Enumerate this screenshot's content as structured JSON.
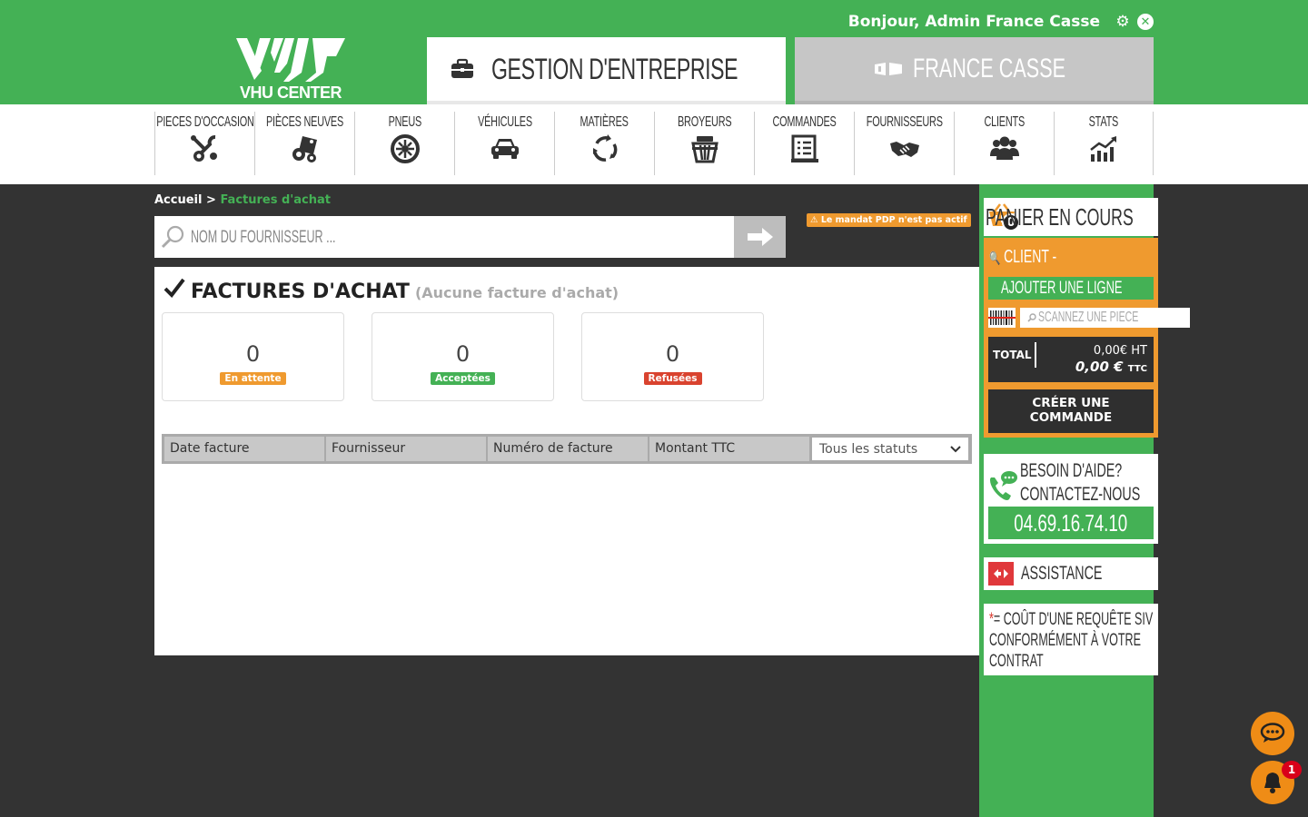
{
  "header": {
    "greeting": "Bonjour, Admin France Casse",
    "logo_text": "VHU CENTER",
    "tab_gestion": "GESTION D'ENTREPRISE",
    "tab_france": "FRANCE CASSE"
  },
  "nav": {
    "items": [
      {
        "label": "PIECES D'OCCASION",
        "icon": "tools-icon"
      },
      {
        "label": "PIÈCES NEUVES",
        "icon": "new-parts-icon"
      },
      {
        "label": "PNEUS",
        "icon": "tire-icon"
      },
      {
        "label": "VÉHICULES",
        "icon": "car-icon"
      },
      {
        "label": "MATIÈRES",
        "icon": "recycle-icon"
      },
      {
        "label": "BROYEURS",
        "icon": "shredder-icon"
      },
      {
        "label": "COMMANDES",
        "icon": "orders-icon"
      },
      {
        "label": "FOURNISSEURS",
        "icon": "handshake-icon"
      },
      {
        "label": "CLIENTS",
        "icon": "users-icon"
      },
      {
        "label": "STATS",
        "icon": "stats-icon"
      }
    ]
  },
  "breadcrumb": {
    "home": "Accueil",
    "separator": ">",
    "current": "Factures d'achat"
  },
  "search": {
    "placeholder": "NOM DU FOURNISSEUR ..."
  },
  "pdp_warning": "⚠ Le mandat PDP n'est pas actif",
  "main": {
    "title": "FACTURES D'ACHAT",
    "subtitle": "(Aucune facture d'achat)",
    "cards": [
      {
        "count": "0",
        "label": "En attente",
        "color": "#ef9a2f"
      },
      {
        "count": "0",
        "label": "Acceptées",
        "color": "#44b155"
      },
      {
        "count": "0",
        "label": "Refusées",
        "color": "#d9432f"
      }
    ],
    "columns": [
      "Date facture",
      "Fournisseur",
      "Numéro de facture",
      "Montant TTC"
    ],
    "status_filter": "Tous les statuts"
  },
  "cart": {
    "title": "PANIER EN COURS",
    "count": "0",
    "client_label": "CLIENT -",
    "add_line": "AJOUTER UNE LIGNE",
    "scan_placeholder": "SCANNEZ UNE PIECE",
    "total_label": "TOTAL",
    "total_ht": "0,00€ HT",
    "total_ttc": "0,00 €",
    "ttc_unit": "TTC",
    "create_line1": "CRÉER UNE",
    "create_line2": "COMMANDE"
  },
  "help": {
    "line1": "BESOIN D'AIDE?",
    "line2": "CONTACTEZ-NOUS",
    "phone": "04.69.16.74.10"
  },
  "assistance": "ASSISTANCE",
  "siv_note": {
    "star": "*",
    "line1": "= COÛT D'UNE REQUÊTE SIV",
    "line2": "CONFORMÉMENT À VOTRE",
    "line3": "CONTRAT"
  },
  "notifications": {
    "badge": "1"
  },
  "colors": {
    "brand_green": "#44b155",
    "accent_orange": "#ef9a2f",
    "dark_bg": "#333333"
  }
}
